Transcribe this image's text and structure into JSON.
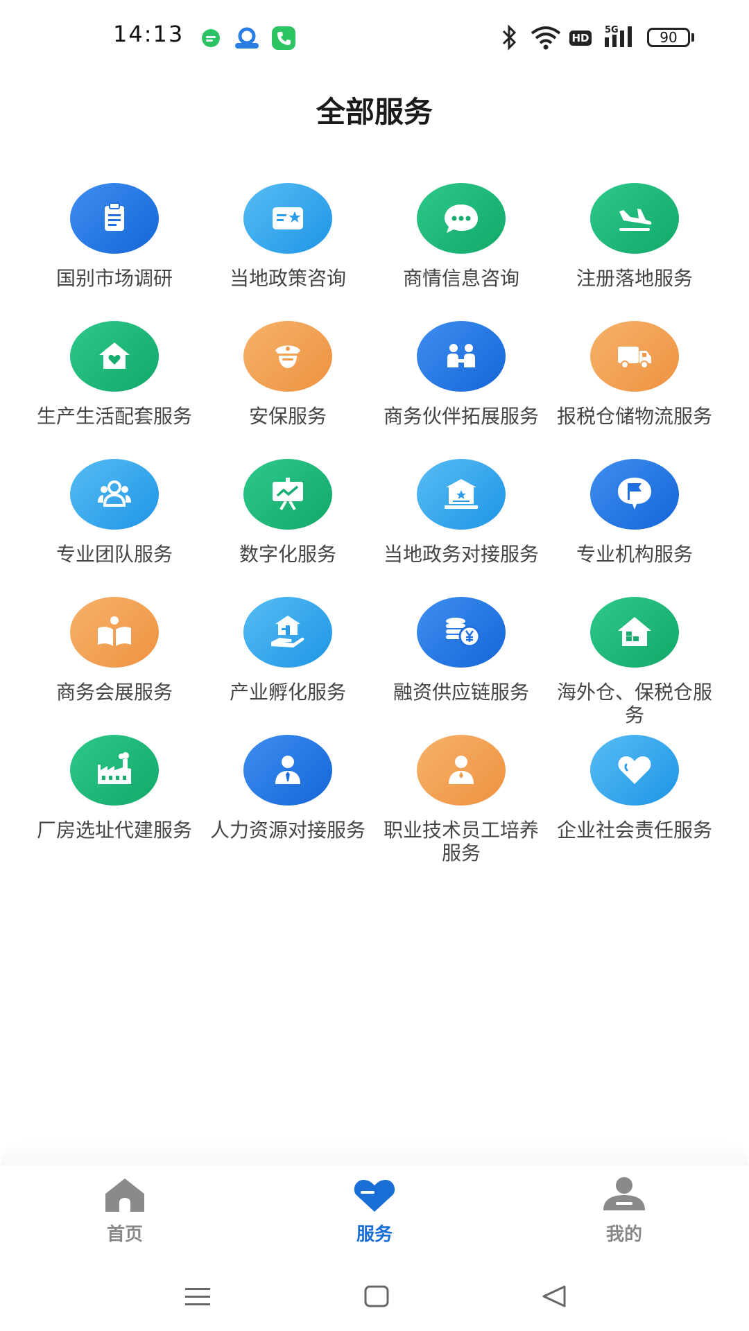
{
  "status_bar": {
    "time": "14:13",
    "battery": "90",
    "network": "5G",
    "hd": "HD",
    "icons": [
      "message-icon",
      "ai-app-icon",
      "phone-icon",
      "bluetooth-icon",
      "wifi-icon",
      "hd-icon",
      "signal-icon",
      "battery-icon"
    ]
  },
  "page": {
    "title": "全部服务"
  },
  "services": [
    {
      "label": "国别市场调研",
      "icon": "clipboard-icon",
      "color": "blue"
    },
    {
      "label": "当地政策咨询",
      "icon": "id-card-star-icon",
      "color": "sky"
    },
    {
      "label": "商情信息咨询",
      "icon": "chat-bubble-icon",
      "color": "green"
    },
    {
      "label": "注册落地服务",
      "icon": "airplane-landing-icon",
      "color": "green"
    },
    {
      "label": "生产生活配套服务",
      "icon": "home-heart-icon",
      "color": "green"
    },
    {
      "label": "安保服务",
      "icon": "guard-icon",
      "color": "orange"
    },
    {
      "label": "商务伙伴拓展服务",
      "icon": "partners-icon",
      "color": "blue"
    },
    {
      "label": "报税仓储物流服务",
      "icon": "truck-icon",
      "color": "orange"
    },
    {
      "label": "专业团队服务",
      "icon": "team-icon",
      "color": "sky"
    },
    {
      "label": "数字化服务",
      "icon": "presentation-chart-icon",
      "color": "green"
    },
    {
      "label": "当地政务对接服务",
      "icon": "government-building-icon",
      "color": "sky"
    },
    {
      "label": "专业机构服务",
      "icon": "flag-bubble-icon",
      "color": "blue"
    },
    {
      "label": "商务会展服务",
      "icon": "open-book-icon",
      "color": "orange"
    },
    {
      "label": "产业孵化服务",
      "icon": "hand-building-icon",
      "color": "sky"
    },
    {
      "label": "融资供应链服务",
      "icon": "coins-yen-icon",
      "color": "blue"
    },
    {
      "label": "海外仓、保税仓服务",
      "icon": "warehouse-icon",
      "color": "green"
    },
    {
      "label": "厂房选址代建服务",
      "icon": "factory-icon",
      "color": "green"
    },
    {
      "label": "人力资源对接服务",
      "icon": "businessman-icon",
      "color": "blue"
    },
    {
      "label": "职业技术员工培养服务",
      "icon": "worker-icon",
      "color": "orange"
    },
    {
      "label": "企业社会责任服务",
      "icon": "heart-icon",
      "color": "sky"
    }
  ],
  "bottom_nav": [
    {
      "label": "首页",
      "icon": "home-icon",
      "active": false
    },
    {
      "label": "服务",
      "icon": "service-heart-icon",
      "active": true
    },
    {
      "label": "我的",
      "icon": "profile-icon",
      "active": false
    }
  ],
  "system_nav": [
    "menu-icon",
    "home-square-icon",
    "back-triangle-icon"
  ],
  "colors": {
    "blue": "#1565d8",
    "sky": "#1f94e6",
    "green": "#12a86a",
    "orange": "#ee9240",
    "active_tab": "#1a6fd6"
  }
}
